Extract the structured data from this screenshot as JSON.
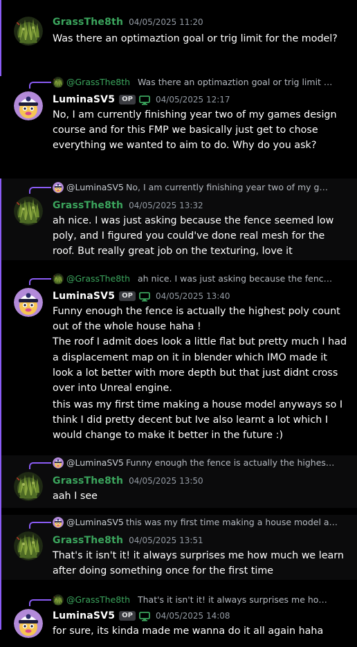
{
  "users": {
    "grass": {
      "name": "GrassThe8th",
      "color": "#3ba55d"
    },
    "lumina": {
      "name": "LuminaSV5",
      "color": "#ffffff",
      "badge": "OP"
    }
  },
  "accent_color": "#8b5cf6",
  "messages": [
    {
      "author": "GrassThe8th",
      "timestamp": "04/05/2025 11:20",
      "text": "Was there an optimaztion goal or trig limit for the model?"
    },
    {
      "author": "LuminaSV5",
      "badge": "OP",
      "timestamp": "04/05/2025 12:17",
      "reply_name": "@GrassThe8th",
      "reply_text": "Was there an optimaztion goal or trig limit …",
      "text": "No, I am currently finishing year two of my games design course and for this FMP we basically just get to chose everything we wanted to aim to do. Why do you ask?"
    },
    {
      "author": "GrassThe8th",
      "timestamp": "04/05/2025 13:32",
      "reply_name": "@LuminaSV5",
      "reply_text": "No, I am currently finishing year two of my g…",
      "text": "ah nice. I was just asking because the fence seemed low poly, and I figured you could've done real mesh for the roof. But really great job on the texturing, love it"
    },
    {
      "author": "LuminaSV5",
      "badge": "OP",
      "timestamp": "04/05/2025 13:40",
      "reply_name": "@GrassThe8th",
      "reply_text": "ah nice. I was just asking because the fenc…",
      "text": "Funny enough the fence is actually the highest poly count out of the whole house haha !\nThe roof I admit does look a little flat but pretty much I had a displacement map on it in blender which IMO made it look a lot better with more depth but that just didnt cross over into Unreal engine.",
      "text2": "this was my first time making a house model anyways so I think I did pretty decent but Ive also learnt a lot which I would change to make it better in the future :)"
    },
    {
      "author": "GrassThe8th",
      "timestamp": "04/05/2025 13:50",
      "reply_name": "@LuminaSV5",
      "reply_text": "Funny enough the fence is actually the highes…",
      "text": "aah I see"
    },
    {
      "author": "GrassThe8th",
      "timestamp": "04/05/2025 13:51",
      "reply_name": "@LuminaSV5",
      "reply_text": "this was my first time making a house model a…",
      "text": "That's it isn't it! it always surprises me how much we learn after doing something once for the first time"
    },
    {
      "author": "LuminaSV5",
      "badge": "OP",
      "timestamp": "04/05/2025 14:08",
      "reply_name": "@GrassThe8th",
      "reply_text": "That's it isn't it! it always surprises me ho…",
      "text": "for sure, its kinda made me wanna do it all again haha"
    }
  ]
}
